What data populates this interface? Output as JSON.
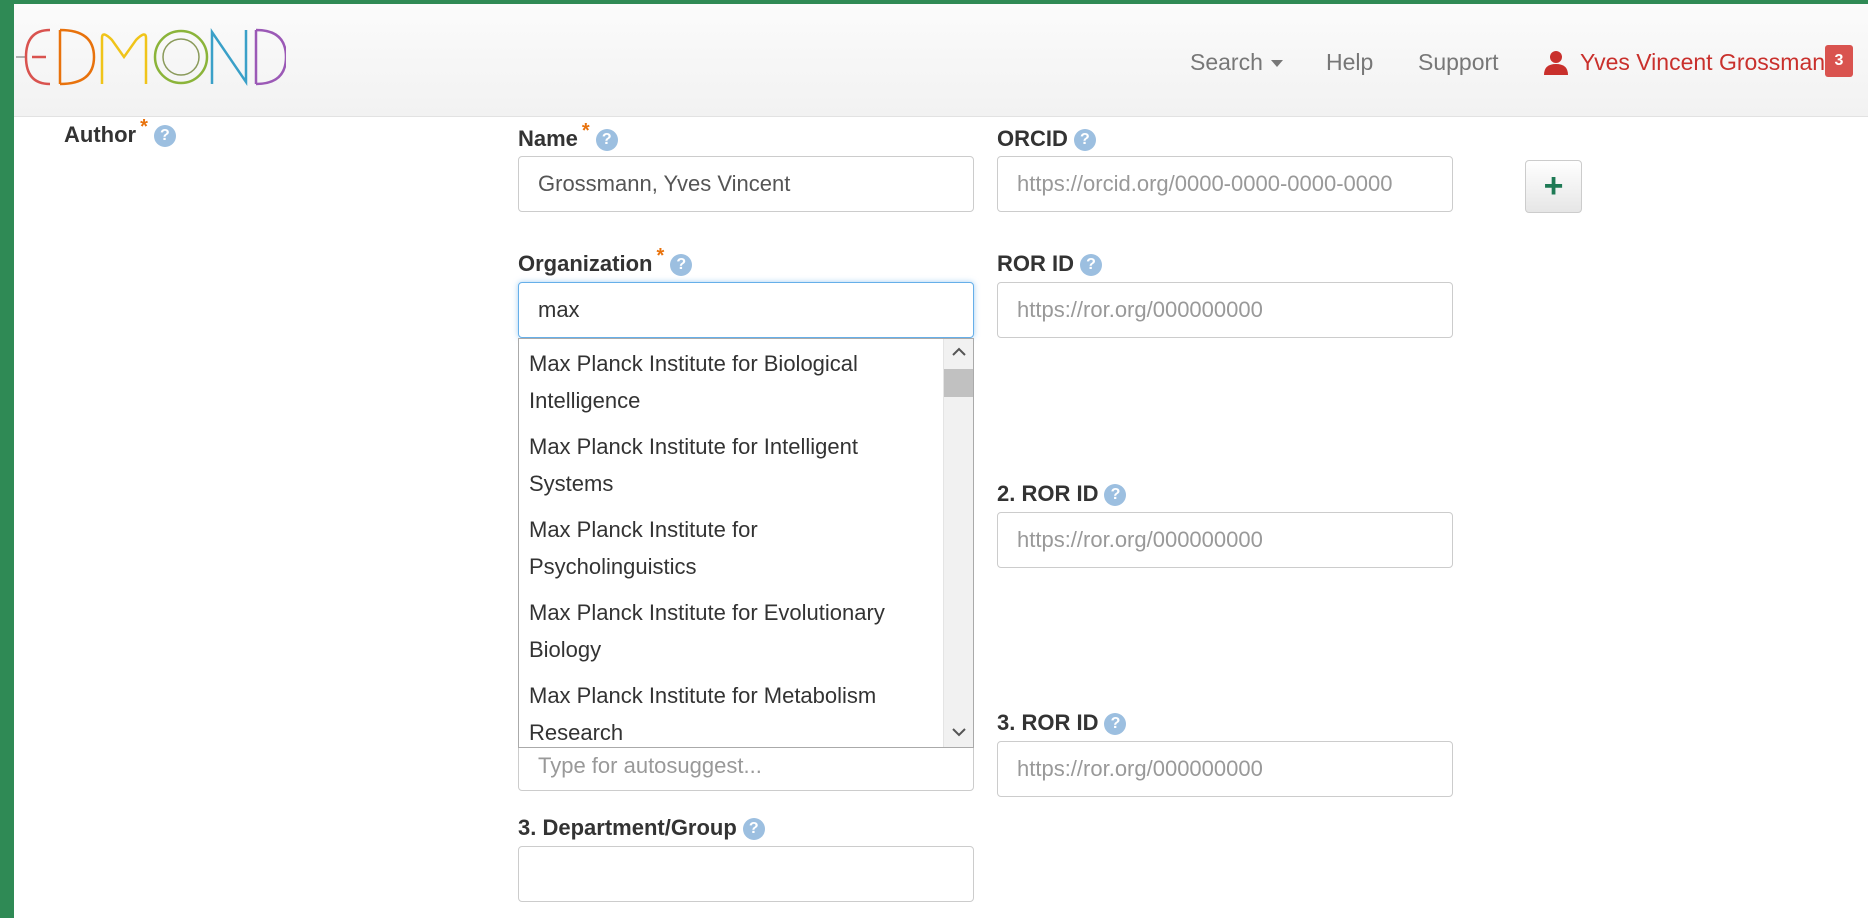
{
  "nav": {
    "logo_text": "EDMOND",
    "search": "Search",
    "help": "Help",
    "support": "Support",
    "user": "Yves Vincent Grossmann",
    "badge": "3"
  },
  "form": {
    "author_label": "Author",
    "name_label": "Name",
    "name_value": "Grossmann, Yves Vincent",
    "orcid_label": "ORCID",
    "orcid_placeholder": "https://orcid.org/0000-0000-0000-0000",
    "add_button": "+",
    "organization_label": "Organization",
    "organization_value": "max",
    "ror_label": "ROR ID",
    "ror_placeholder": "https://ror.org/000000000",
    "ror2_label": "2. ROR ID",
    "ror2_placeholder": "https://ror.org/000000000",
    "ror3_label": "3. ROR ID",
    "ror3_placeholder": "https://ror.org/000000000",
    "autosuggest_placeholder": "Type for autosuggest...",
    "dept3_label": "3. Department/Group",
    "required_mark": "*",
    "help_mark": "?"
  },
  "suggestions": [
    {
      "line1": "Max Planck Institute for Biological",
      "line2": "Intelligence"
    },
    {
      "line1": "Max Planck Institute for Intelligent",
      "line2": "Systems"
    },
    {
      "line1": "Max Planck Institute for",
      "line2": "Psycholinguistics"
    },
    {
      "line1": "Max Planck Institute for Evolutionary",
      "line2": "Biology"
    },
    {
      "line1": "Max Planck Institute for Metabolism",
      "line2": "Research"
    }
  ],
  "colors": {
    "accent_green": "#1e7a55",
    "required_orange": "#e8720c",
    "user_red": "#c9302c",
    "help_blue": "#9cbfe0"
  }
}
